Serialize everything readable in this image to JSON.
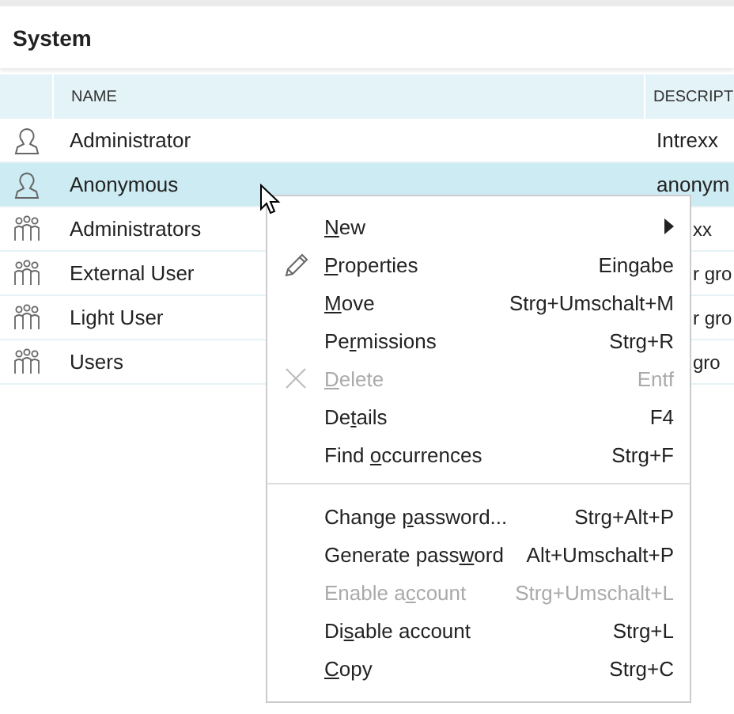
{
  "panel": {
    "title": "System"
  },
  "table": {
    "columns": [
      "NAME",
      "DESCRIPT"
    ],
    "rows": [
      {
        "kind": "user",
        "name": "Administrator",
        "description": "Intrexx",
        "selected": false
      },
      {
        "kind": "user",
        "name": "Anonymous",
        "description": "anonym",
        "selected": true
      },
      {
        "kind": "group",
        "name": "Administrators",
        "description": "xx",
        "selected": false
      },
      {
        "kind": "group",
        "name": "External User",
        "description": "r gro",
        "selected": false
      },
      {
        "kind": "group",
        "name": "Light User",
        "description": "r gro",
        "selected": false
      },
      {
        "kind": "group",
        "name": "Users",
        "description": "gro",
        "selected": false
      }
    ]
  },
  "context_menu": {
    "sections": [
      [
        {
          "kind": "submenu",
          "label": {
            "key": "N",
            "after": "ew"
          },
          "disabled": false
        },
        {
          "kind": "edit",
          "label": {
            "key": "P",
            "after": "roperties"
          },
          "shortcut": "Eingabe",
          "disabled": false
        },
        {
          "kind": "plain",
          "label": {
            "key": "M",
            "after": "ove"
          },
          "shortcut": "Strg+Umschalt+M",
          "disabled": false
        },
        {
          "kind": "plain",
          "label": {
            "before": "Pe",
            "key": "r",
            "after": "missions"
          },
          "shortcut": "Strg+R",
          "disabled": false
        },
        {
          "kind": "delete",
          "label": {
            "key": "D",
            "after": "elete"
          },
          "shortcut": "Entf",
          "disabled": true
        },
        {
          "kind": "plain",
          "label": {
            "before": "De",
            "key": "t",
            "after": "ails"
          },
          "shortcut": "F4",
          "disabled": false
        },
        {
          "kind": "plain",
          "label": {
            "before": "Find ",
            "key": "o",
            "after": "ccurrences"
          },
          "shortcut": "Strg+F",
          "disabled": false
        }
      ],
      [
        {
          "kind": "plain",
          "label": {
            "before": "Change ",
            "key": "p",
            "after": "assword..."
          },
          "shortcut": "Strg+Alt+P",
          "disabled": false
        },
        {
          "kind": "plain",
          "label": {
            "before": "Generate pass",
            "key": "w",
            "after": "ord"
          },
          "shortcut": "Alt+Umschalt+P",
          "disabled": false
        },
        {
          "kind": "plain",
          "label": {
            "before": "Enable a",
            "key": "c",
            "after": "count"
          },
          "shortcut": "Strg+Umschalt+L",
          "disabled": true
        },
        {
          "kind": "plain",
          "label": {
            "before": "Di",
            "key": "s",
            "after": "able account"
          },
          "shortcut": "Strg+L",
          "disabled": false
        },
        {
          "kind": "plain",
          "label": {
            "key": "C",
            "after": "opy"
          },
          "shortcut": "Strg+C",
          "disabled": false
        }
      ]
    ]
  }
}
